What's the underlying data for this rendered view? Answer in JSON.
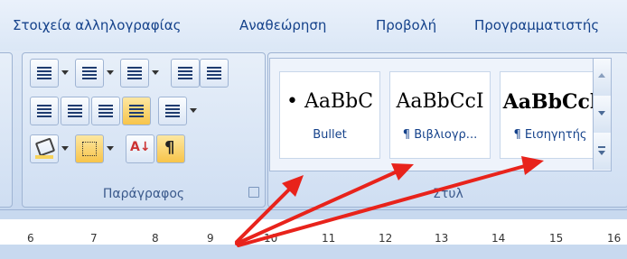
{
  "tabs": [
    "Στοιχεία αλληλογραφίας",
    "Αναθεώρηση",
    "Προβολή",
    "Προγραμματιστής"
  ],
  "paragraph_group": {
    "label": "Παράγραφος",
    "pilcrow": "¶",
    "sort_glyph": "A↓"
  },
  "styles_group": {
    "label": "Στυλ",
    "items": [
      {
        "preview": "• AaBbC",
        "name": "Bullet"
      },
      {
        "preview": "AaBbCcI",
        "name": "¶ Βιβλιογρ..."
      },
      {
        "preview": "AaBbCcl",
        "name": "¶ Εισηγητής"
      }
    ]
  },
  "ruler": {
    "numbers": [
      "6",
      "7",
      "8",
      "9",
      "10",
      "11",
      "12",
      "13",
      "14",
      "15",
      "16"
    ]
  },
  "colors": {
    "arrow": "#e8231b",
    "highlight": "#f7d35c",
    "accent": "#15428b"
  }
}
